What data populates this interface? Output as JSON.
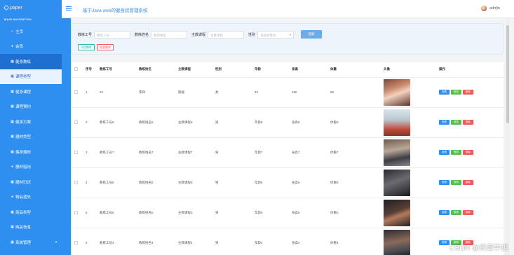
{
  "brand": {
    "name": "paper"
  },
  "sidebar": {
    "section_label": "MAIN NAVIGATION",
    "items": [
      {
        "label": "主页",
        "icon": "home-icon",
        "glyph": "⌂"
      },
      {
        "label": "会员",
        "icon": "person-icon",
        "glyph": "●"
      },
      {
        "label": "健身教练",
        "icon": "grid-icon",
        "glyph": "▦"
      },
      {
        "label": "课程类型",
        "icon": "grid-icon",
        "glyph": "▦"
      },
      {
        "label": "健身课程",
        "icon": "grid-icon",
        "glyph": "▦"
      },
      {
        "label": "课程预约",
        "icon": "grid-icon",
        "glyph": "▦"
      },
      {
        "label": "健身方案",
        "icon": "grid-icon",
        "glyph": "▦"
      },
      {
        "label": "器材类型",
        "icon": "grid-icon",
        "glyph": "▦"
      },
      {
        "label": "健身器材",
        "icon": "grid-icon",
        "glyph": "▦"
      },
      {
        "label": "器材借用",
        "icon": "bulb-icon",
        "glyph": "●"
      },
      {
        "label": "器材归还",
        "icon": "grid-icon",
        "glyph": "▦"
      },
      {
        "label": "物品遗失",
        "icon": "location-icon",
        "glyph": "●"
      },
      {
        "label": "商品类型",
        "icon": "grid-icon",
        "glyph": "▦"
      },
      {
        "label": "商品信息",
        "icon": "grid-icon",
        "glyph": "▦"
      },
      {
        "label": "系统管理",
        "icon": "grid-icon",
        "glyph": "▦"
      }
    ]
  },
  "header": {
    "title": "基于Java web的健身房管理系统",
    "user": "admin",
    "kebab": "⋮"
  },
  "search": {
    "labels": [
      "教练工号",
      "教练姓名",
      "主教课程",
      "性别"
    ],
    "placeholders": [
      "教练工号",
      "教练姓名",
      "主教课程"
    ],
    "select_placeholder": "请选择性别",
    "search_button": "搜索",
    "add_button": "添加教练",
    "batch_delete_button": "批量删除"
  },
  "table": {
    "headers": [
      "序号",
      "教练工号",
      "教练姓名",
      "主教课程",
      "性别",
      "年龄",
      "身高",
      "体重",
      "头像",
      "操作"
    ],
    "rows": [
      [
        "1",
        "22",
        "李四",
        "瑜伽",
        "女",
        "22",
        "180",
        "69"
      ],
      [
        "2",
        "教练工号8",
        "教练姓名8",
        "主教课程8",
        "男",
        "年龄8",
        "身高8",
        "体重8"
      ],
      [
        "3",
        "教练工号7",
        "教练姓名7",
        "主教课程7",
        "男",
        "年龄7",
        "身高7",
        "体重7"
      ],
      [
        "4",
        "教练工号6",
        "教练姓名6",
        "主教课程6",
        "男",
        "年龄6",
        "身高6",
        "体重6"
      ],
      [
        "5",
        "教练工号5",
        "教练姓名5",
        "主教课程5",
        "男",
        "年龄5",
        "身高5",
        "体重5"
      ],
      [
        "6",
        "教练工号4",
        "教练姓名4",
        "主教课程4",
        "男",
        "年龄4",
        "身高4",
        "体重4"
      ]
    ],
    "actions": [
      "查看",
      "修改",
      "删除"
    ]
  },
  "watermark": "CSDN @熊茹学姐"
}
